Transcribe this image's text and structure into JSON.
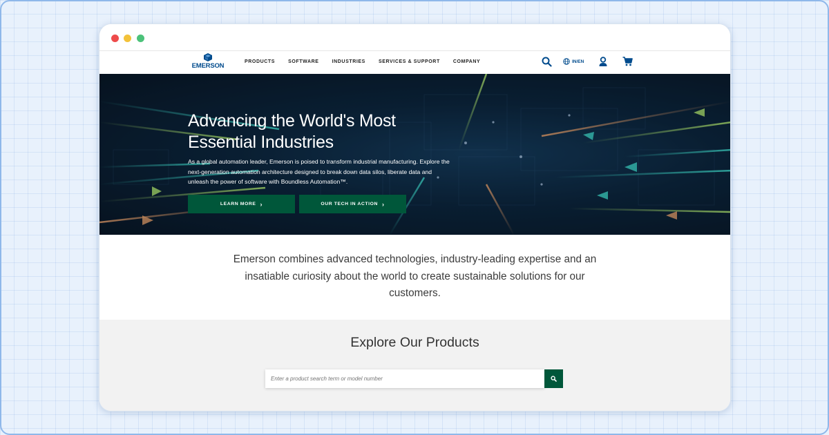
{
  "brand": {
    "name": "EMERSON",
    "color": "#004b8d",
    "accent": "#00573a"
  },
  "nav": {
    "items": [
      "PRODUCTS",
      "SOFTWARE",
      "INDUSTRIES",
      "SERVICES & SUPPORT",
      "COMPANY"
    ],
    "language": "IN/EN",
    "icons": [
      "search-icon",
      "globe-icon",
      "user-icon",
      "cart-icon"
    ]
  },
  "hero": {
    "title": "Advancing the World's Most Essential Industries",
    "description": "As a global automation leader, Emerson is poised to transform industrial manufacturing. Explore the next-generation automation architecture designed to break down data silos, liberate data and unleash the power of software with Boundless Automation™.",
    "buttons": {
      "learn_more": "LEARN MORE",
      "tech": "OUR TECH IN ACTION"
    }
  },
  "intro": {
    "text": "Emerson combines advanced technologies, industry-leading expertise and an insatiable curiosity about the world to create sustainable solutions for our customers."
  },
  "explore": {
    "title": "Explore Our Products",
    "search_placeholder": "Enter a product search term or model number"
  }
}
